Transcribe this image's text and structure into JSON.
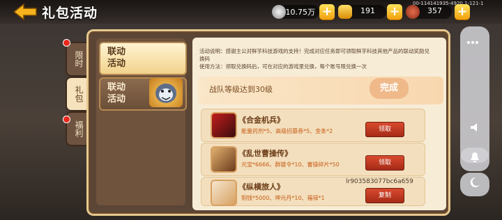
{
  "header": {
    "title": "礼包活动",
    "serial": "00-114141935-4920.1-121-1",
    "resources": [
      {
        "icon": "silver-coin-icon",
        "value": "10.75万",
        "color": "#c0c0c0"
      },
      {
        "icon": "gold-ingot-icon",
        "value": "191",
        "color": "#f2b51c"
      },
      {
        "icon": "meat-icon",
        "value": "357",
        "color": "#b6432c"
      }
    ]
  },
  "side_tabs": [
    {
      "label": "限时",
      "active": false,
      "dot": true
    },
    {
      "label": "礼包",
      "active": true,
      "dot": false
    },
    {
      "label": "福利",
      "active": false,
      "dot": true
    }
  ],
  "menu": [
    {
      "label_line1": "联动",
      "label_line2": "活动",
      "active": true
    },
    {
      "label_line1": "联动",
      "label_line2": "活动",
      "active": false
    }
  ],
  "description": {
    "line1": "活动说明：感谢主公对鲜芋科技游戏的支持！完成对应任务即可领取鲜芋科技其他产品的联动奖励兑换码",
    "line2": "使用方法：领取兑换码后，可在对应的游戏里兑换，每个账号限兑换一次"
  },
  "banner": {
    "text": "战队等级达到30级",
    "button": "完成"
  },
  "rows": [
    {
      "name": "《合金机兵》",
      "desc": "能量药剂*5、高级招募券*5、金条*2",
      "button": "领取"
    },
    {
      "name": "《乱世曹操传》",
      "desc": "元宝*6666、群雄令*10、曹操碎片*50",
      "button": "领取"
    },
    {
      "name": "《纵横旅人》",
      "desc": "铜钱*5000、坤元丹*10、福禄*1",
      "button": "复制",
      "code": "lr903583077bc6a659"
    }
  ],
  "right_panel": {
    "volume_icon": "speaker-icon",
    "bell_icon": "bell-icon",
    "moon_icon": "moon-icon"
  }
}
